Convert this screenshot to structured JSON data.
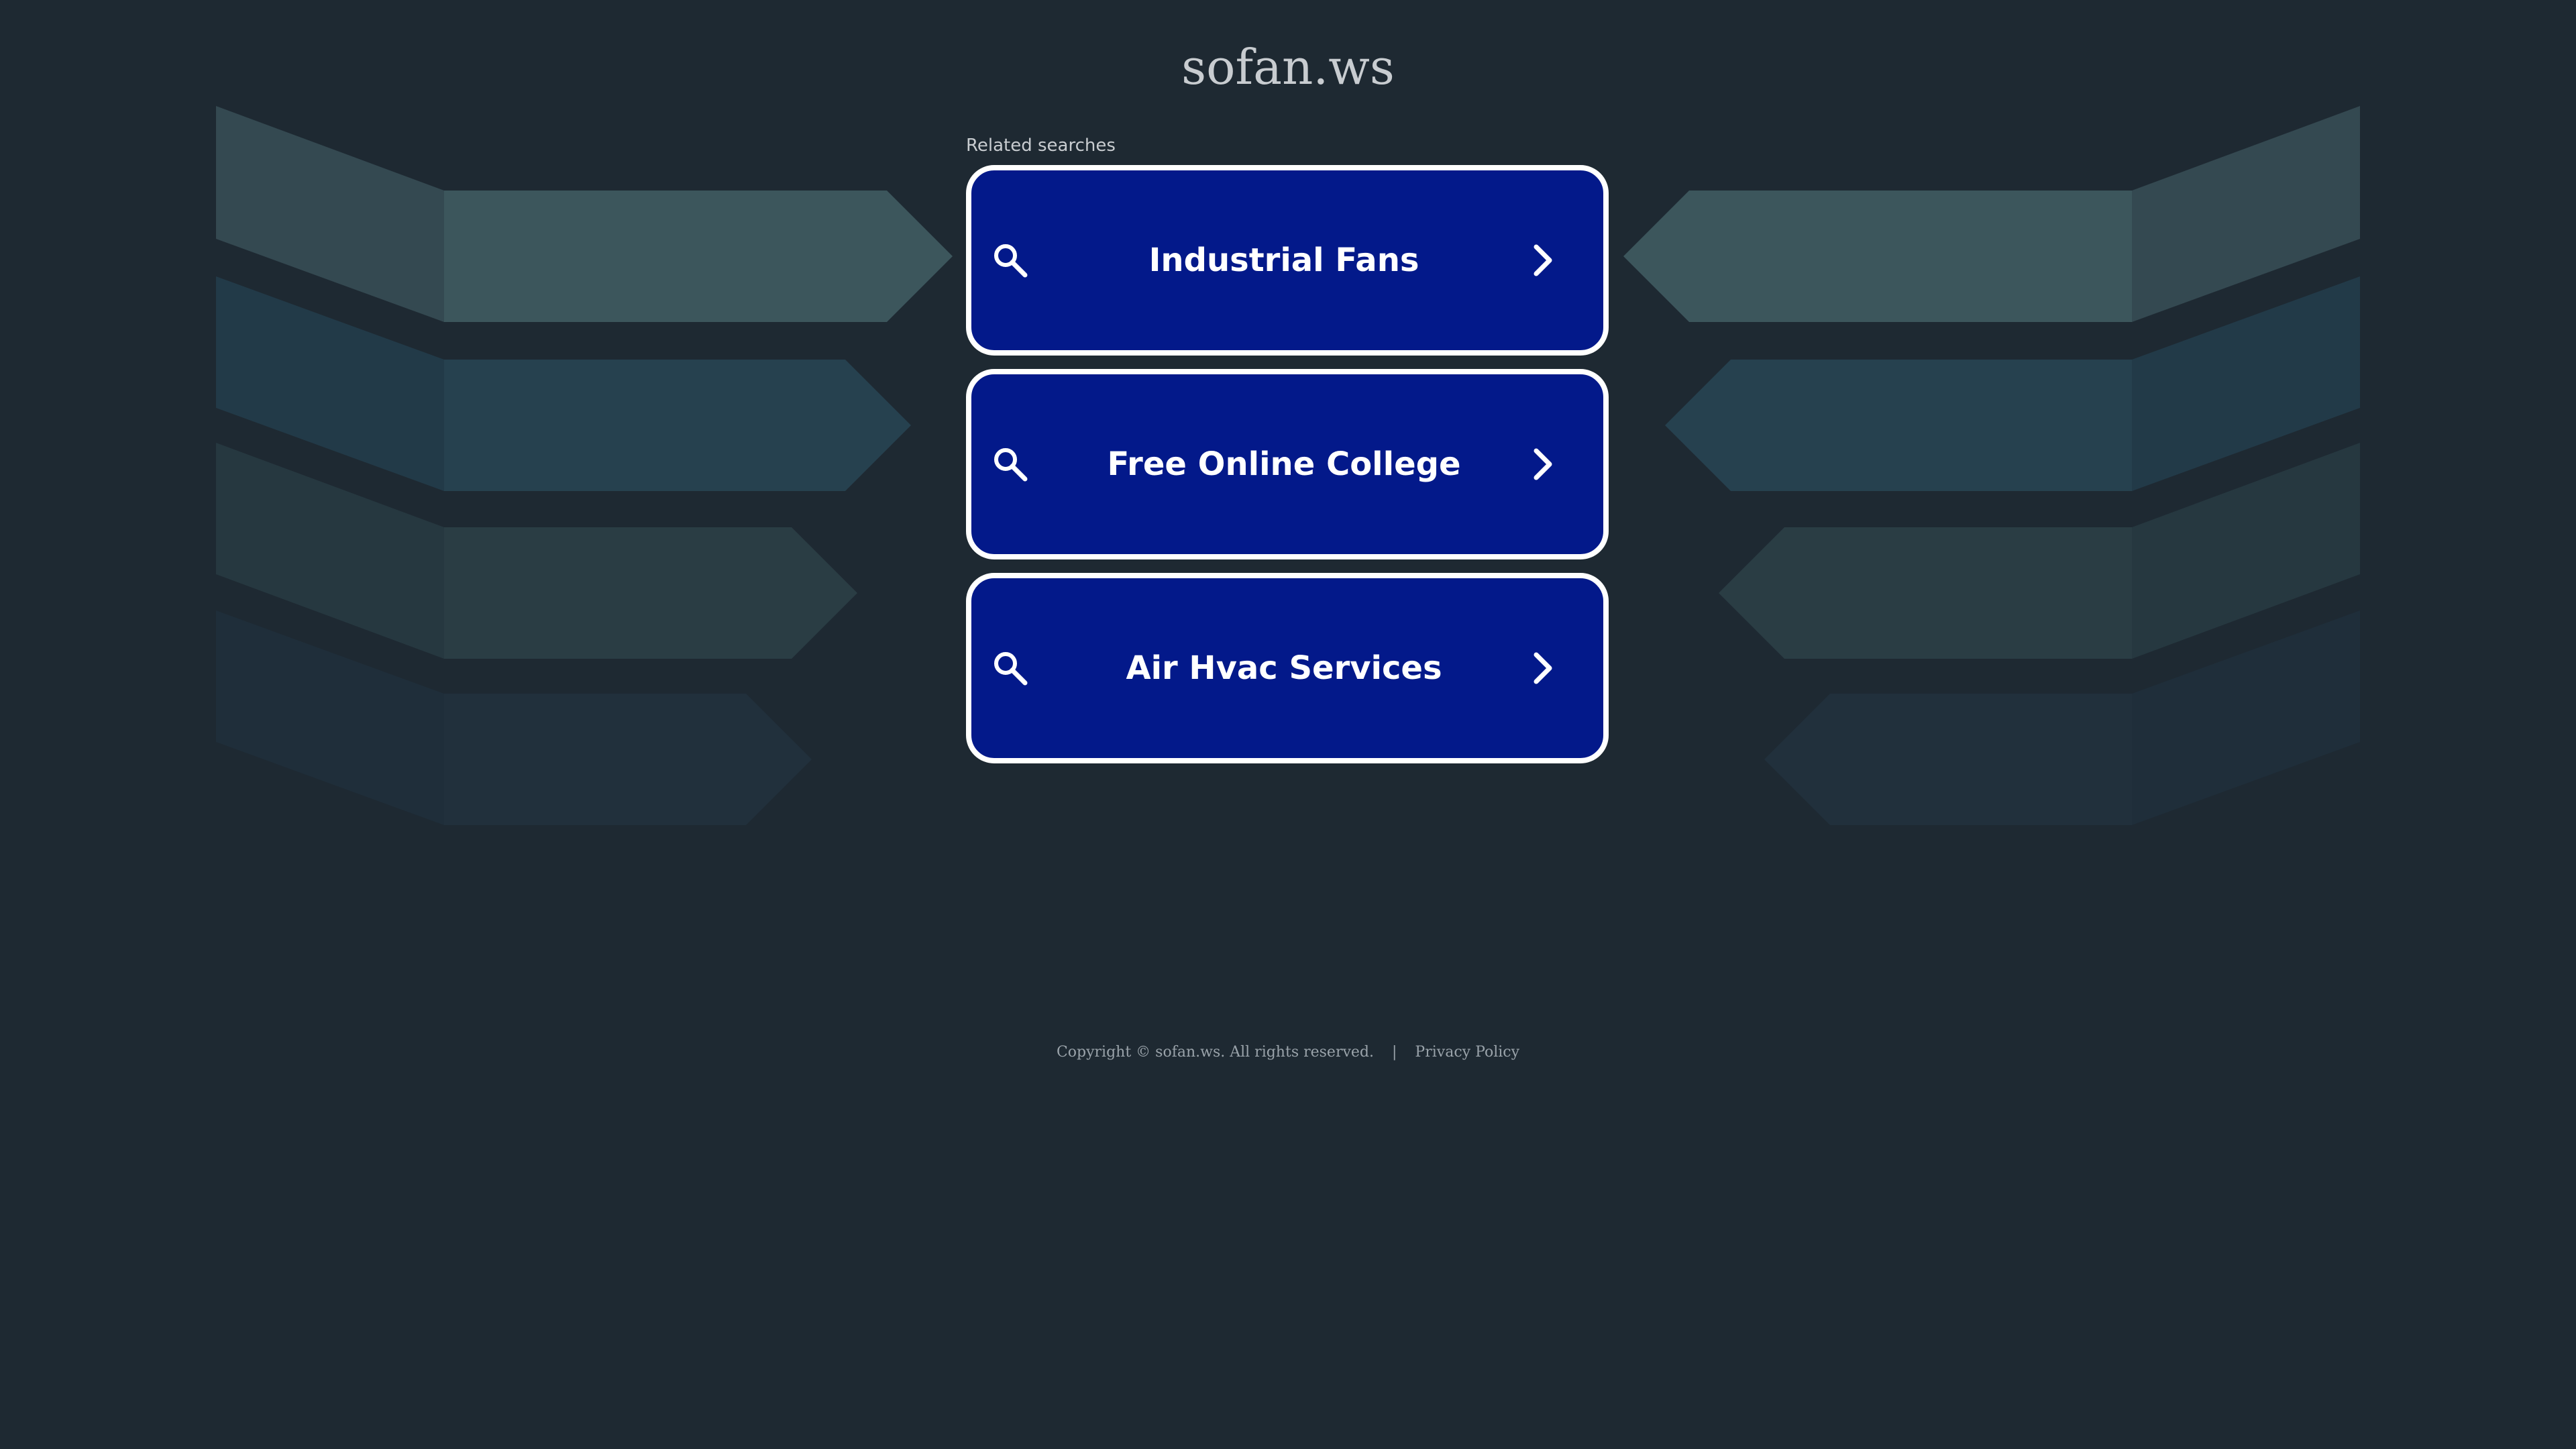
{
  "site": {
    "title": "sofan.ws"
  },
  "related": {
    "label": "Related searches",
    "links": [
      {
        "label": "Industrial Fans"
      },
      {
        "label": "Free Online College"
      },
      {
        "label": "Air Hvac Services"
      }
    ]
  },
  "footer": {
    "copyright": "Copyright © sofan.ws.  All rights reserved.",
    "separator": "|",
    "privacy_label": "Privacy Policy"
  },
  "colors": {
    "background": "#1e2932",
    "button_fill": "#03198a",
    "button_border": "#ffffff",
    "title_text": "#c8ccd0",
    "footer_text": "#9aa3aa"
  },
  "icons": {
    "left": "search-icon",
    "right": "chevron-right-icon"
  }
}
